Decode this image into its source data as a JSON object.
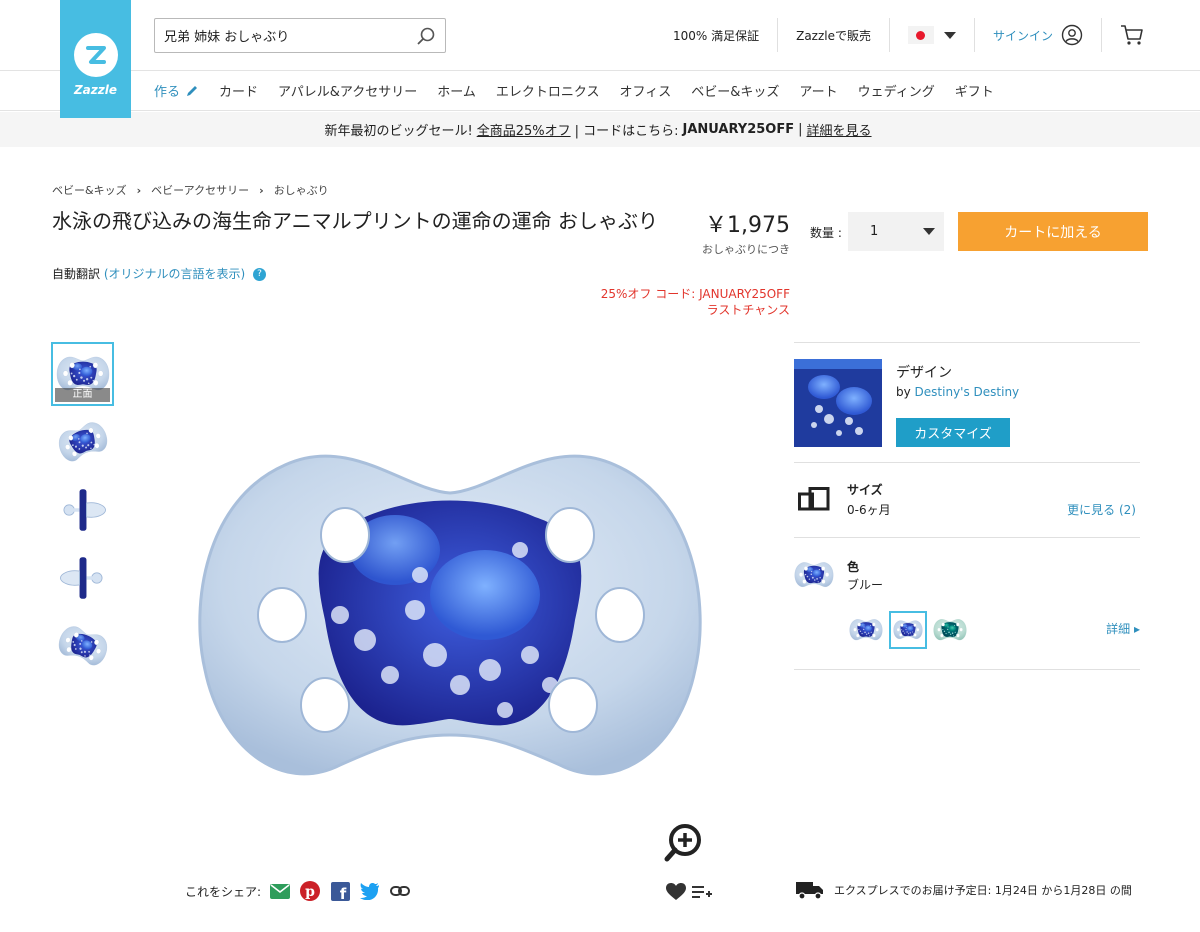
{
  "header": {
    "logo_text": "Zazzle",
    "search_value": "兄弟 姉妹 おしゃぶり",
    "links": [
      "100% 満足保証",
      "Zazzleで販売"
    ],
    "signin": "サインイン"
  },
  "nav": [
    "作る",
    "カード",
    "アパレル&アクセサリー",
    "ホーム",
    "エレクトロニクス",
    "オフィス",
    "ベビー&キッズ",
    "アート",
    "ウェディング",
    "ギフト"
  ],
  "promo": {
    "lead": "新年最初のビッグセール!",
    "offer": "全商品25%オフ",
    "code_label": "| コードはこちら:",
    "code": "JANUARY25OFF",
    "sep": "|",
    "details": "詳細を見る"
  },
  "breadcrumbs": [
    "ベビー&キッズ",
    "ベビーアクセサリー",
    "おしゃぶり"
  ],
  "product": {
    "title": "水泳の飛び込みの海生命アニマルプリントの運命の運命 おしゃぶり",
    "auto_translate": "自動翻訳",
    "show_original": "(オリジナルの言語を表示)",
    "price": "￥1,975",
    "price_unit": "おしゃぶりにつき",
    "discount_line1": "25%オフ コード: JANUARY25OFF",
    "discount_line2": "ラストチャンス",
    "qty_label": "数量 :",
    "qty_value": "1",
    "cart_button": "カートに加える",
    "thumb_front_label": "正面"
  },
  "panel": {
    "design_title": "デザイン",
    "by_prefix": "by",
    "designer": "Destiny's Destiny",
    "customize": "カスタマイズ",
    "size_title": "サイズ",
    "size_value": "0-6ヶ月",
    "size_more": "更に見る (2)",
    "color_title": "色",
    "color_value": "ブルー",
    "color_details": "詳細"
  },
  "share": {
    "label": "これをシェア:"
  },
  "delivery": "エクスプレスでのお届け予定日: 1月24日 から1月28日 の間",
  "colors": {
    "brand": "#47bde2",
    "cart": "#f7a131",
    "link": "#2f8fbd",
    "discount": "#e2352c",
    "pacifier": "#c5d6ea",
    "design_blue": "#2a3fb8"
  }
}
